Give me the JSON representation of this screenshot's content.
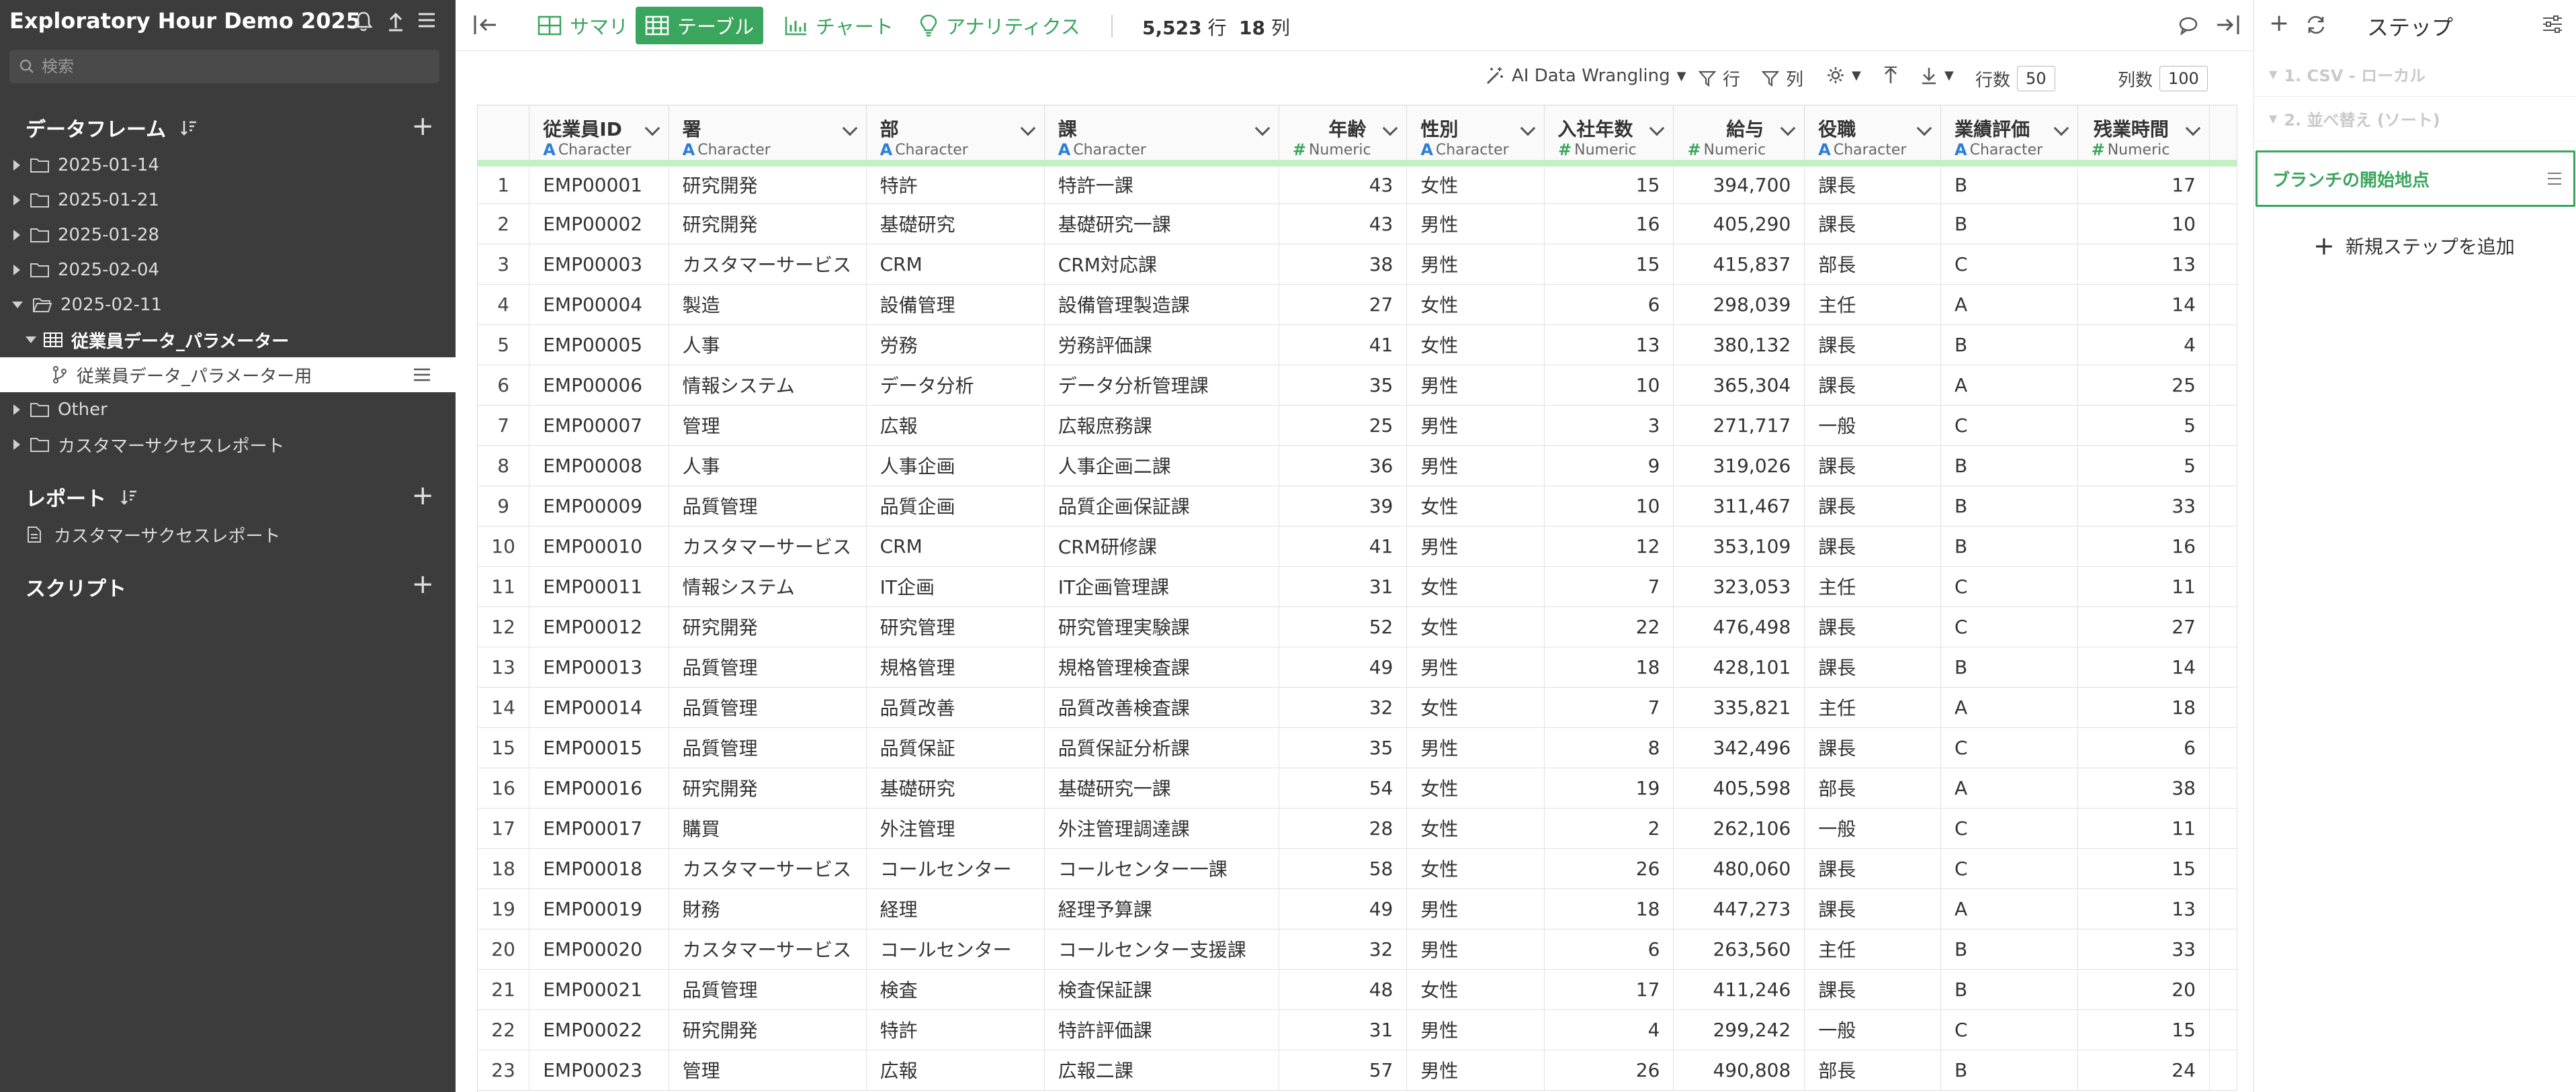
{
  "app": {
    "title": "Exploratory Hour Demo 2025"
  },
  "sidebar": {
    "search_placeholder": "検索",
    "dataframes_title": "データフレーム",
    "reports_title": "レポート",
    "scripts_title": "スクリプト",
    "folders": [
      {
        "label": "2025-01-14"
      },
      {
        "label": "2025-01-21"
      },
      {
        "label": "2025-01-28"
      },
      {
        "label": "2025-02-04"
      },
      {
        "label": "2025-02-11"
      }
    ],
    "dataframe": {
      "label": "従業員データ_パラメーター"
    },
    "branch": {
      "label": "従業員データ_パラメーター用"
    },
    "other_folders": [
      {
        "label": "Other"
      },
      {
        "label": "カスタマーサクセスレポート"
      }
    ],
    "report_item": {
      "label": "カスタマーサクセスレポート"
    }
  },
  "toolbar": {
    "tabs": [
      {
        "label": "サマリ",
        "icon": "grid-icon"
      },
      {
        "label": "テーブル",
        "icon": "table-icon"
      },
      {
        "label": "チャート",
        "icon": "chart-icon"
      },
      {
        "label": "アナリティクス",
        "icon": "bulb-icon"
      }
    ],
    "row_count": "5,523",
    "row_unit": "行",
    "col_count": "18",
    "col_unit": "列"
  },
  "subbar": {
    "ai_label": "AI Data Wrangling",
    "row_filter": "行",
    "col_filter": "列",
    "rows_label": "行数",
    "rows_value": "50",
    "cols_label": "列数",
    "cols_value": "100"
  },
  "table": {
    "columns": [
      {
        "name": "従業員ID",
        "type": "Character",
        "kind": "char"
      },
      {
        "name": "署",
        "type": "Character",
        "kind": "char"
      },
      {
        "name": "部",
        "type": "Character",
        "kind": "char"
      },
      {
        "name": "課",
        "type": "Character",
        "kind": "char"
      },
      {
        "name": "年齢",
        "type": "Numeric",
        "kind": "num"
      },
      {
        "name": "性別",
        "type": "Character",
        "kind": "char"
      },
      {
        "name": "入社年数",
        "type": "Numeric",
        "kind": "num"
      },
      {
        "name": "給与",
        "type": "Numeric",
        "kind": "num"
      },
      {
        "name": "役職",
        "type": "Character",
        "kind": "char"
      },
      {
        "name": "業績評価",
        "type": "Character",
        "kind": "char"
      },
      {
        "name": "残業時間",
        "type": "Numeric",
        "kind": "num"
      }
    ],
    "rows": [
      [
        "1",
        "EMP00001",
        "研究開発",
        "特許",
        "特許一課",
        "43",
        "女性",
        "15",
        "394,700",
        "課長",
        "B",
        "17"
      ],
      [
        "2",
        "EMP00002",
        "研究開発",
        "基礎研究",
        "基礎研究一課",
        "43",
        "男性",
        "16",
        "405,290",
        "課長",
        "B",
        "10"
      ],
      [
        "3",
        "EMP00003",
        "カスタマーサービス",
        "CRM",
        "CRM対応課",
        "38",
        "男性",
        "15",
        "415,837",
        "部長",
        "C",
        "13"
      ],
      [
        "4",
        "EMP00004",
        "製造",
        "設備管理",
        "設備管理製造課",
        "27",
        "女性",
        "6",
        "298,039",
        "主任",
        "A",
        "14"
      ],
      [
        "5",
        "EMP00005",
        "人事",
        "労務",
        "労務評価課",
        "41",
        "女性",
        "13",
        "380,132",
        "課長",
        "B",
        "4"
      ],
      [
        "6",
        "EMP00006",
        "情報システム",
        "データ分析",
        "データ分析管理課",
        "35",
        "男性",
        "10",
        "365,304",
        "課長",
        "A",
        "25"
      ],
      [
        "7",
        "EMP00007",
        "管理",
        "広報",
        "広報庶務課",
        "25",
        "男性",
        "3",
        "271,717",
        "一般",
        "C",
        "5"
      ],
      [
        "8",
        "EMP00008",
        "人事",
        "人事企画",
        "人事企画二課",
        "36",
        "男性",
        "9",
        "319,026",
        "課長",
        "B",
        "5"
      ],
      [
        "9",
        "EMP00009",
        "品質管理",
        "品質企画",
        "品質企画保証課",
        "39",
        "女性",
        "10",
        "311,467",
        "課長",
        "B",
        "33"
      ],
      [
        "10",
        "EMP00010",
        "カスタマーサービス",
        "CRM",
        "CRM研修課",
        "41",
        "男性",
        "12",
        "353,109",
        "課長",
        "B",
        "16"
      ],
      [
        "11",
        "EMP00011",
        "情報システム",
        "IT企画",
        "IT企画管理課",
        "31",
        "女性",
        "7",
        "323,053",
        "主任",
        "C",
        "11"
      ],
      [
        "12",
        "EMP00012",
        "研究開発",
        "研究管理",
        "研究管理実験課",
        "52",
        "女性",
        "22",
        "476,498",
        "課長",
        "C",
        "27"
      ],
      [
        "13",
        "EMP00013",
        "品質管理",
        "規格管理",
        "規格管理検査課",
        "49",
        "男性",
        "18",
        "428,101",
        "課長",
        "B",
        "14"
      ],
      [
        "14",
        "EMP00014",
        "品質管理",
        "品質改善",
        "品質改善検査課",
        "32",
        "女性",
        "7",
        "335,821",
        "主任",
        "A",
        "18"
      ],
      [
        "15",
        "EMP00015",
        "品質管理",
        "品質保証",
        "品質保証分析課",
        "35",
        "男性",
        "8",
        "342,496",
        "課長",
        "C",
        "6"
      ],
      [
        "16",
        "EMP00016",
        "研究開発",
        "基礎研究",
        "基礎研究一課",
        "54",
        "女性",
        "19",
        "405,598",
        "部長",
        "A",
        "38"
      ],
      [
        "17",
        "EMP00017",
        "購買",
        "外注管理",
        "外注管理調達課",
        "28",
        "女性",
        "2",
        "262,106",
        "一般",
        "C",
        "11"
      ],
      [
        "18",
        "EMP00018",
        "カスタマーサービス",
        "コールセンター",
        "コールセンター一課",
        "58",
        "女性",
        "26",
        "480,060",
        "課長",
        "C",
        "15"
      ],
      [
        "19",
        "EMP00019",
        "財務",
        "経理",
        "経理予算課",
        "49",
        "男性",
        "18",
        "447,273",
        "課長",
        "A",
        "13"
      ],
      [
        "20",
        "EMP00020",
        "カスタマーサービス",
        "コールセンター",
        "コールセンター支援課",
        "32",
        "男性",
        "6",
        "263,560",
        "主任",
        "B",
        "33"
      ],
      [
        "21",
        "EMP00021",
        "品質管理",
        "検査",
        "検査保証課",
        "48",
        "女性",
        "17",
        "411,246",
        "課長",
        "B",
        "20"
      ],
      [
        "22",
        "EMP00022",
        "研究開発",
        "特許",
        "特許評価課",
        "31",
        "男性",
        "4",
        "299,242",
        "一般",
        "C",
        "15"
      ],
      [
        "23",
        "EMP00023",
        "管理",
        "広報",
        "広報二課",
        "57",
        "男性",
        "26",
        "490,808",
        "部長",
        "B",
        "24"
      ]
    ]
  },
  "steps": {
    "title": "ステップ",
    "faded": [
      {
        "label": "1. CSV - ローカル"
      },
      {
        "label": "2. 並べ替え (ソート)"
      }
    ],
    "branch_label": "ブランチの開始地点",
    "add_label": "新規ステップを追加"
  },
  "colors": {
    "accent": "#3aa55d",
    "sidebar_bg": "#3c3c3c",
    "type_char": "#2d7fd6",
    "header_bar": "#c5efc5"
  }
}
